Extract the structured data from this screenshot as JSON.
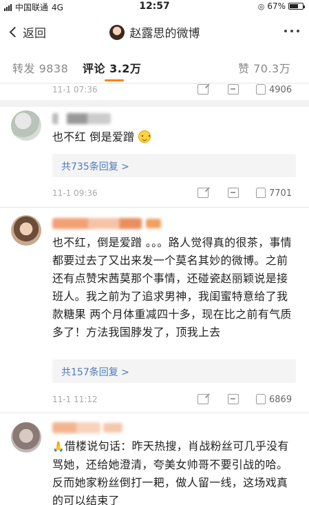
{
  "status_bar": {
    "carrier": "中国联通",
    "network": "4G",
    "time": "12:57",
    "battery": "67%",
    "battery_level": 0.67
  },
  "nav": {
    "back_label": "返回",
    "title": "赵露思的微博"
  },
  "tabs": {
    "repost": "转发 9838",
    "comment": "评论 3.2万",
    "like": "赞 70.3万"
  },
  "comments": [
    {
      "time": "11-1 07:36",
      "likes": "4906"
    },
    {
      "text": "也不红 倒是爱蹭 ",
      "reply_link": "共735条回复 >",
      "time": "11-1 09:36",
      "likes": "7701"
    },
    {
      "text": "也不红，倒是爱蹭 。。。路人觉得真的很茶，事情都要过去了又出来发一个莫名其妙的微博。之前还有点赞宋茜莫那个事情，还碰瓷赵丽颖说是接班人。我之前为了追求男神，我闺蜜特意给了我款糖果 两个月体重减四十多，现在比之前有气质多了！方法我国脖发了，顶我上去",
      "reply_link": "共157条回复 >",
      "time": "11-1 11:12",
      "likes": "6869"
    },
    {
      "text": "借楼说句话：昨天热搜，肖战粉丝可几乎没有骂她，还给她澄清，夸美女帅哥不要引战的哈。反而她家粉丝倒打一耙，做人留一线，这场戏真的可以结束了"
    }
  ],
  "colors": {
    "accent": "#ff8200",
    "link": "#4a7ab8"
  }
}
